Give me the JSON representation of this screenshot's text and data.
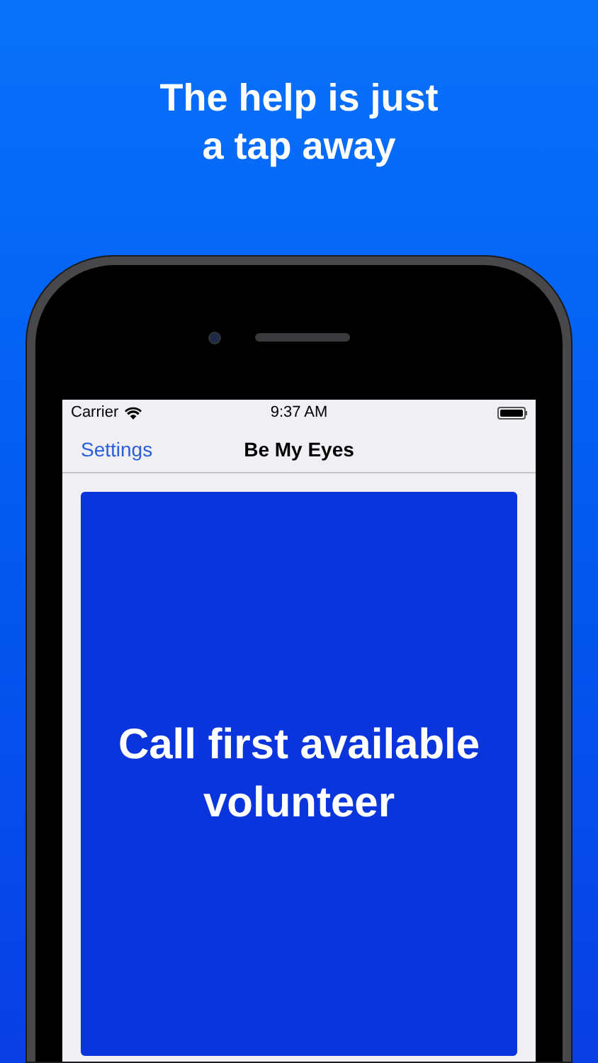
{
  "headline": "The help is just a tap away",
  "status_bar": {
    "carrier": "Carrier",
    "time": "9:37 AM"
  },
  "nav_bar": {
    "back": "Settings",
    "title": "Be My Eyes"
  },
  "main_button": {
    "label": "Call first available volunteer"
  }
}
